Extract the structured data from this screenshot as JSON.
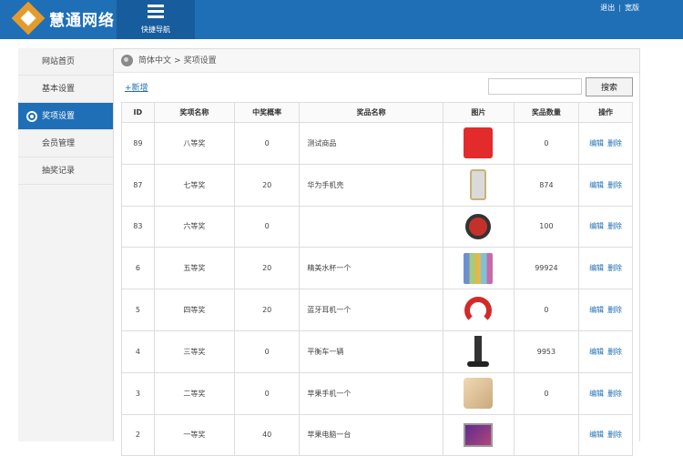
{
  "header": {
    "brand": "慧通网络",
    "quicknav_label": "快捷导航",
    "logout": "退出",
    "widescreen": "宽版",
    "brand_color": "#1f6fb6",
    "logo_color": "#e59b2c"
  },
  "sidebar": {
    "items": [
      {
        "label": "网站首页",
        "icon": "",
        "active": false
      },
      {
        "label": "基本设置",
        "icon": "",
        "active": false
      },
      {
        "label": "奖项设置",
        "icon": "gear-icon",
        "active": true
      },
      {
        "label": "会员管理",
        "icon": "",
        "active": false
      },
      {
        "label": "抽奖记录",
        "icon": "",
        "active": false
      }
    ]
  },
  "breadcrumb": {
    "root": "简体中文",
    "separator": ">",
    "current": "奖项设置"
  },
  "toolbar": {
    "add_label": "+新增",
    "search_value": "",
    "search_button": "搜索"
  },
  "table": {
    "headers": [
      "ID",
      "奖项名称",
      "中奖概率",
      "奖品名称",
      "图片",
      "奖品数量",
      "操作"
    ],
    "edit_label": "编辑",
    "delete_label": "删除",
    "rows": [
      {
        "id": "89",
        "level": "八等奖",
        "prob": "0",
        "prize": "测试商品",
        "image": "red-box-image",
        "qty": "0"
      },
      {
        "id": "87",
        "level": "七等奖",
        "prob": "20",
        "prize": "华为手机壳",
        "image": "phone-case-image",
        "qty": "874"
      },
      {
        "id": "83",
        "level": "六等奖",
        "prob": "0",
        "prize": "",
        "image": "robot-vacuum-image",
        "qty": "100"
      },
      {
        "id": "6",
        "level": "五等奖",
        "prob": "20",
        "prize": "精美水杯一个",
        "image": "water-cups-image",
        "qty": "99924"
      },
      {
        "id": "5",
        "level": "四等奖",
        "prob": "20",
        "prize": "蓝牙耳机一个",
        "image": "headphones-image",
        "qty": "0"
      },
      {
        "id": "4",
        "level": "三等奖",
        "prob": "0",
        "prize": "平衡车一辆",
        "image": "balance-scooter-image",
        "qty": "9953"
      },
      {
        "id": "3",
        "level": "二等奖",
        "prob": "0",
        "prize": "苹果手机一个",
        "image": "iphone-image",
        "qty": "0"
      },
      {
        "id": "2",
        "level": "一等奖",
        "prob": "40",
        "prize": "苹果电脑一台",
        "image": "macbook-image",
        "qty": ""
      }
    ]
  }
}
